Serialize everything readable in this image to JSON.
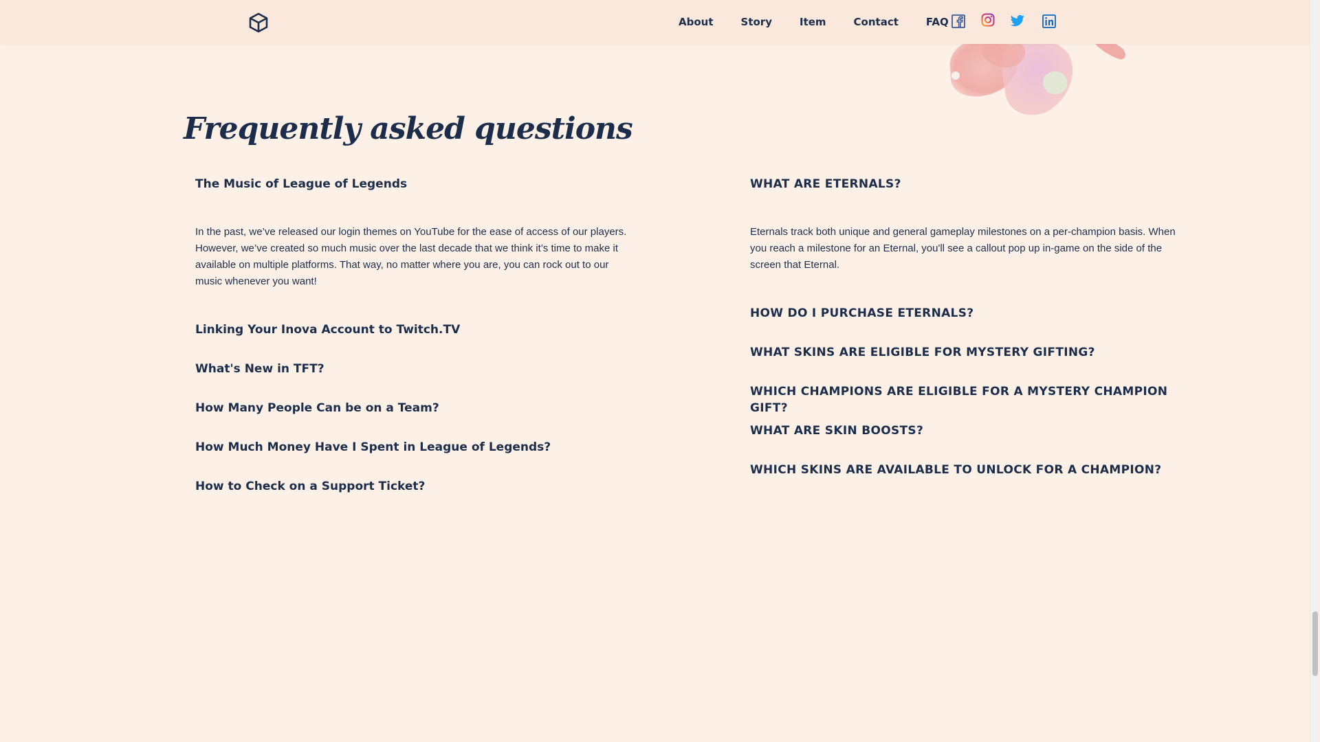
{
  "nav": {
    "items": [
      "About",
      "Story",
      "Item",
      "Contact",
      "FAQ"
    ]
  },
  "social": {
    "icons": [
      "facebook-icon",
      "instagram-icon",
      "twitter-icon",
      "linkedin-icon"
    ],
    "colors": {
      "facebook": "#3b5998",
      "instagram": "#e1306c",
      "twitter": "#1da1f2",
      "linkedin": "#0a66c2"
    }
  },
  "faq": {
    "title": "Frequently asked questions",
    "left": {
      "open_question": "The Music of League of Legends",
      "open_answer": "In the past, we’ve released our login themes on YouTube for the ease of access of our players. However, we’ve created so much music over the last decade that we think it’s time to make it available on multiple platforms. That way, no matter where you are, you can rock out to our music whenever you want!",
      "questions": [
        "Linking Your Inova Account to Twitch.TV",
        "What's New in TFT?",
        "How Many People Can be on a Team?",
        "How Much Money Have I Spent in League of Legends?",
        "How to Check on a Support Ticket?"
      ]
    },
    "right": {
      "open_question": "WHAT ARE ETERNALS?",
      "open_answer": "Eternals track both unique and general gameplay milestones on a per-champion basis. When you reach a milestone for an Eternal, you'll see a callout pop up in-game on the side of the screen that Eternal.",
      "questions": [
        "HOW DO I PURCHASE ETERNALS?",
        "WHAT SKINS ARE ELIGIBLE FOR MYSTERY GIFTING?",
        "WHICH CHAMPIONS ARE ELIGIBLE FOR A MYSTERY CHAMPION GIFT?",
        "WHAT ARE SKIN BOOSTS?",
        "WHICH SKINS ARE AVAILABLE TO UNLOCK FOR A CHAMPION?"
      ]
    }
  },
  "colors": {
    "background": "#fdf1e7",
    "header": "#fae8dc",
    "text": "#1b2d4a"
  }
}
